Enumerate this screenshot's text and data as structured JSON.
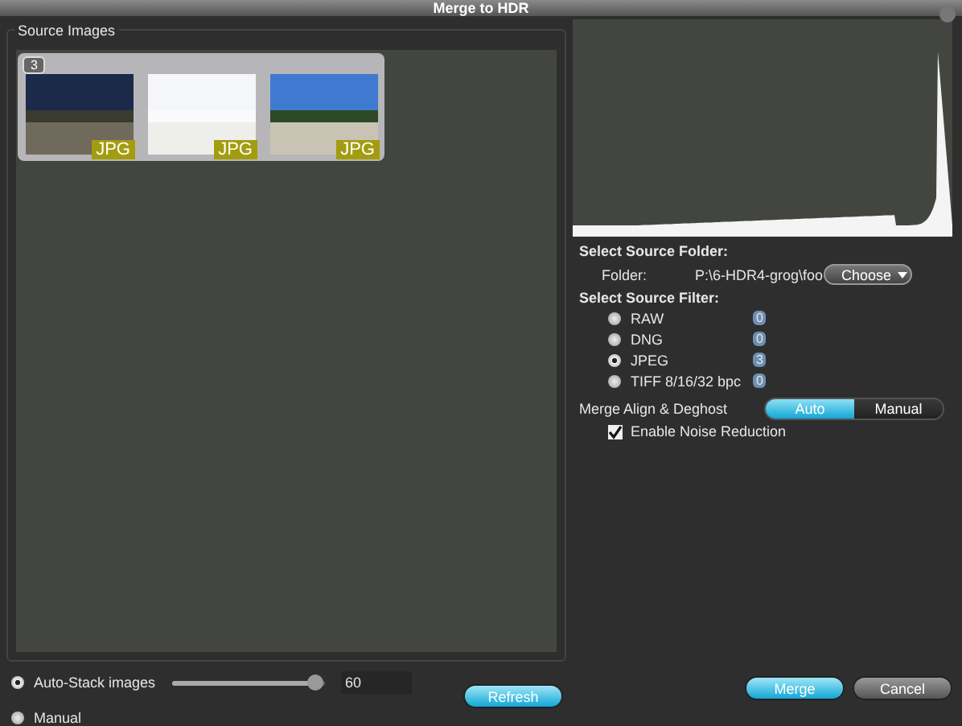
{
  "window": {
    "title": "Merge to HDR"
  },
  "source_images": {
    "title": "Source Images",
    "stack_count": "3",
    "thumbnails": [
      {
        "format": "JPG"
      },
      {
        "format": "JPG"
      },
      {
        "format": "JPG"
      }
    ]
  },
  "folder": {
    "heading": "Select Source Folder:",
    "label": "Folder:",
    "path": "P:\\6-HDR4-grog\\foo",
    "button": "Choose"
  },
  "filter": {
    "heading": "Select Source Filter:",
    "options": [
      {
        "label": "RAW",
        "count": "0",
        "selected": false
      },
      {
        "label": "DNG",
        "count": "0",
        "selected": false
      },
      {
        "label": "JPEG",
        "count": "3",
        "selected": true
      },
      {
        "label": "TIFF 8/16/32 bpc",
        "count": "0",
        "selected": false
      }
    ]
  },
  "align": {
    "label": "Merge Align & Deghost",
    "options": [
      {
        "label": "Auto",
        "selected": true
      },
      {
        "label": "Manual",
        "selected": false
      }
    ]
  },
  "noise_reduction": {
    "label": "Enable Noise Reduction",
    "checked": true
  },
  "stack_mode": [
    {
      "label": "Auto-Stack images",
      "selected": true
    },
    {
      "label": "Manual",
      "selected": false
    }
  ],
  "slider": {
    "level": 0.95,
    "value": "60"
  },
  "buttons": [
    {
      "label": "Refresh",
      "kind": "primary"
    },
    {
      "label": "Merge",
      "kind": "primary"
    },
    {
      "label": "Cancel",
      "kind": "secondary"
    }
  ]
}
